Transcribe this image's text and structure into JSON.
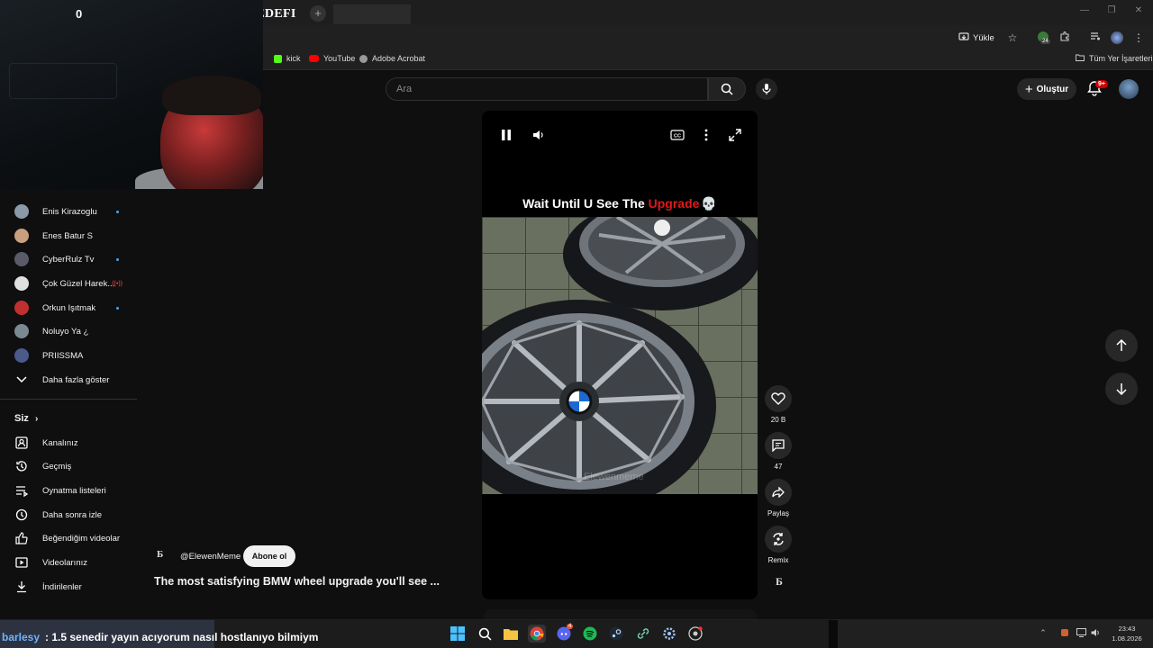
{
  "browser": {
    "tab_title": "ABONE HEDEFI",
    "new_tab_icon": "plus-icon",
    "toolbar": {
      "install_label": "Yükle",
      "extension_badge": "24"
    },
    "bookmarks": [
      {
        "label": "kick",
        "color": "#53fc18"
      },
      {
        "label": "YouTube",
        "color": "#ff0000"
      },
      {
        "label": "Adobe Acrobat",
        "color": "#9a9a9a"
      }
    ],
    "all_bookmarks_label": "Tüm Yer İşaretleri"
  },
  "webcam": {
    "label": "0"
  },
  "header": {
    "search_placeholder": "Ara",
    "create_label": "Oluştur",
    "notif_badge": "9+"
  },
  "sidebar": {
    "subscriptions": [
      {
        "name": "Enis Kirazoglu",
        "indicator": "dot",
        "avatar_color": "#8a9aa8"
      },
      {
        "name": "Enes Batur S",
        "indicator": "",
        "avatar_color": "#c8a080"
      },
      {
        "name": "CyberRulz Tv",
        "indicator": "dot",
        "avatar_color": "#5a5a6a"
      },
      {
        "name": "Çok Güzel Harek...",
        "indicator": "live",
        "avatar_color": "#e0e0e0"
      },
      {
        "name": "Orkun Işıtmak",
        "indicator": "dot",
        "avatar_color": "#c03030"
      },
      {
        "name": "Noluyo Ya ¿",
        "indicator": "",
        "avatar_color": "#7a8a90"
      },
      {
        "name": "PRIISSMA",
        "indicator": "",
        "avatar_color": "#4a5a8a"
      }
    ],
    "show_more_label": "Daha fazla göster",
    "you_header": "Siz",
    "you_items": [
      {
        "label": "Kanalınız",
        "icon": "channel-icon"
      },
      {
        "label": "Geçmiş",
        "icon": "history-icon"
      },
      {
        "label": "Oynatma listeleri",
        "icon": "playlist-icon"
      },
      {
        "label": "Daha sonra izle",
        "icon": "clock-icon"
      },
      {
        "label": "Beğendiğim videolar",
        "icon": "thumbs-up-icon"
      },
      {
        "label": "Videolarınız",
        "icon": "video-icon"
      },
      {
        "label": "İndirilenler",
        "icon": "download-icon"
      }
    ]
  },
  "player": {
    "overlay_text_part1": "Wait Until U See The ",
    "overlay_text_highlight": "Upgrade",
    "overlay_emoji": "💀",
    "watermark": "Elewenmeme"
  },
  "actions": {
    "like_count": "20 B",
    "comment_count": "47",
    "share_label": "Paylaş",
    "remix_label": "Remix",
    "channel_glyph": "Б"
  },
  "video_meta": {
    "channel_glyph": "Б",
    "channel_handle": "@ElewenMeme",
    "subscribe_label": "Abone ol",
    "title": "The most satisfying BMW wheel upgrade you'll see ..."
  },
  "chat": {
    "username": "barlesy",
    "message": ": 1.5 senedir yayın acıyorum nasıl hostlanıyo bilmiym"
  },
  "taskbar": {
    "time": "23:43",
    "date": "1.08.2026",
    "discord_badge": "4"
  }
}
